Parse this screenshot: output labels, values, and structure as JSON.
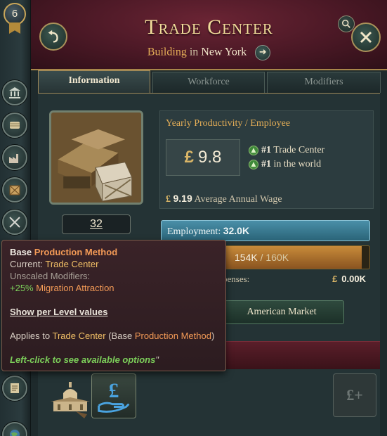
{
  "rank": {
    "value": "6"
  },
  "rail": {
    "items": [
      {
        "icon": "government-icon"
      },
      {
        "icon": "scroll-icon"
      },
      {
        "icon": "factory-icon"
      },
      {
        "icon": "crate-icon"
      },
      {
        "icon": "crossed-swords-icon"
      },
      {
        "icon": "notes-icon"
      },
      {
        "icon": "globe-icon"
      }
    ]
  },
  "header": {
    "title": "Trade Center",
    "subtitle_prefix": "Building",
    "subtitle_in": "in",
    "location": "New York",
    "back_icon": "back-arrow-icon",
    "close_icon": "close-icon",
    "search_icon": "search-icon",
    "goto_icon": "arrow-right-icon"
  },
  "tabs": [
    "Information",
    "Workforce",
    "Modifiers"
  ],
  "building": {
    "level": "32"
  },
  "productivity": {
    "title": "Yearly Productivity / Employee",
    "currency": "£",
    "value": "9.8",
    "rank1_num": "#1",
    "rank1_text": "Trade Center",
    "rank2_num": "#1",
    "rank2_text": "in the world",
    "wage_value": "9.19",
    "wage_label": "Average Annual Wage"
  },
  "employment": {
    "label": "Employment:",
    "value": "32.0K"
  },
  "cash": {
    "value": "154K",
    "sep": "/",
    "max": "160K",
    "fill_fraction": 0.9625
  },
  "expenses": {
    "label": "penses:",
    "currency": "£",
    "value": "0.00K"
  },
  "market": {
    "label": "American Market"
  },
  "production_methods": {
    "first_icon": "trade-center-building-icon",
    "second_icon": "pound-hand-icon",
    "empty_icon": "add-pound-icon",
    "empty_label": "£+"
  },
  "tooltip": {
    "title_prefix": "Base",
    "title_highlight": "Production Method",
    "current_label": "Current:",
    "current_value": "Trade Center",
    "unscaled_label": "Unscaled Modifiers:",
    "modifier_value": "+25%",
    "modifier_name": "Migration Attraction",
    "link_label": "Show per Level values",
    "applies_prefix": "Applies to",
    "applies_building": "Trade Center",
    "applies_paren_open": "(Base",
    "applies_pm": "Production Method",
    "applies_paren_close": ")",
    "hint": "Left-click to see available options",
    "hint_quote": "\""
  }
}
